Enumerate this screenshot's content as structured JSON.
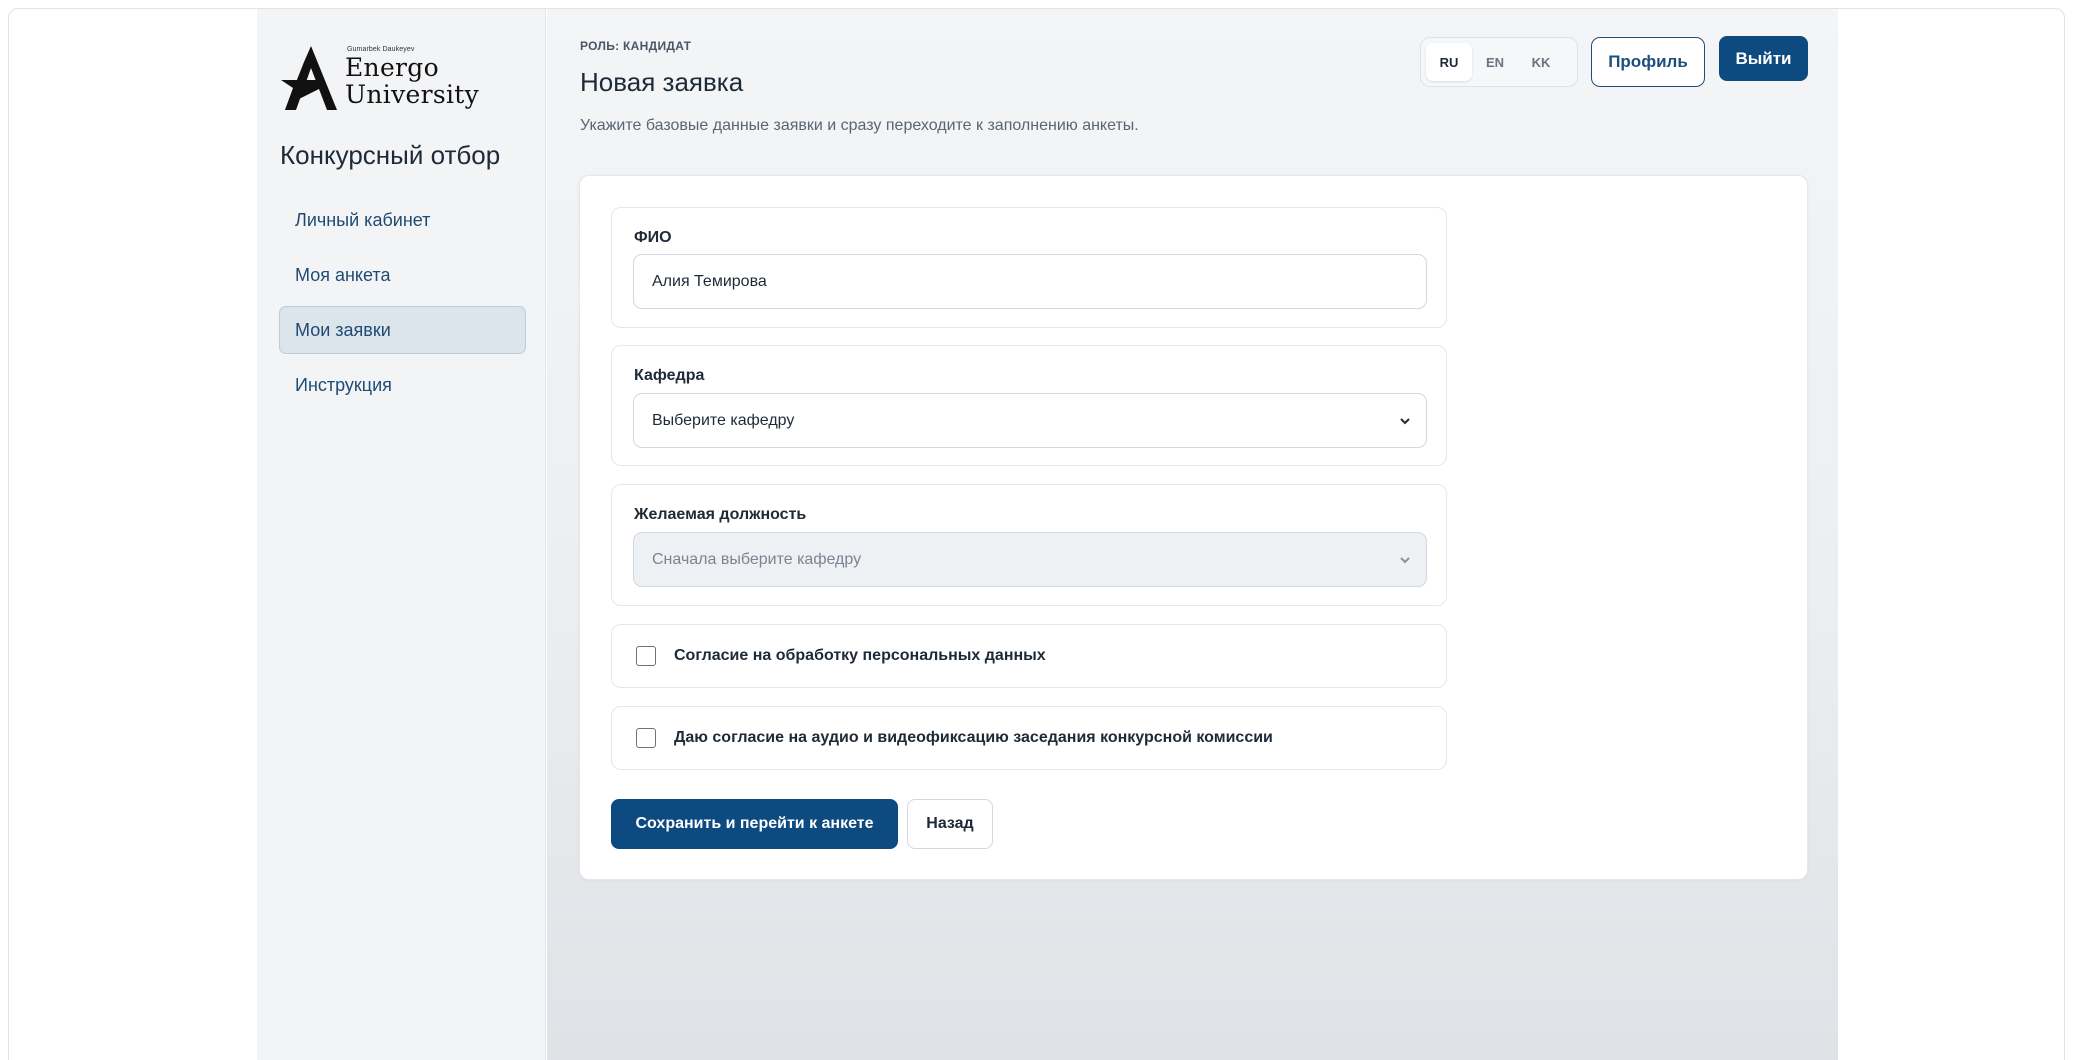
{
  "brand": {
    "logo_small": "Gumarbek Daukeyev",
    "logo_line1": "Energo",
    "logo_line2": "University",
    "title": "Конкурсный отбор"
  },
  "sidebar": {
    "items": [
      {
        "label": "Личный кабинет",
        "active": false
      },
      {
        "label": "Моя анкета",
        "active": false
      },
      {
        "label": "Мои заявки",
        "active": true
      },
      {
        "label": "Инструкция",
        "active": false
      }
    ]
  },
  "header": {
    "role": "РОЛЬ: КАНДИДАТ",
    "title": "Новая заявка",
    "subtitle": "Укажите базовые данные заявки и сразу переходите к заполнению анкеты.",
    "languages": [
      {
        "code": "RU",
        "active": true
      },
      {
        "code": "EN",
        "active": false
      },
      {
        "code": "KK",
        "active": false
      }
    ],
    "profile_label": "Профиль",
    "logout_label": "Выйти"
  },
  "form": {
    "fio": {
      "label": "ФИО",
      "value": "Алия Темирова"
    },
    "department": {
      "label": "Кафедра",
      "selected": "Выберите кафедру"
    },
    "position": {
      "label": "Желаемая должность",
      "selected": "Сначала выберите кафедру",
      "disabled": true
    },
    "consent_personal": {
      "label": "Согласие на обработку персональных данных",
      "checked": false
    },
    "consent_recording": {
      "label": "Даю согласие на аудио и видеофиксацию заседания конкурсной комиссии",
      "checked": false
    },
    "save_label": "Сохранить и перейти к анкете",
    "back_label": "Назад"
  },
  "icons": {
    "logo": "energo-university-logo",
    "select_arrow": "chevron-down-icon"
  },
  "colors": {
    "primary": "#0d4a80",
    "nav_text": "#1e4b73",
    "nav_active_bg": "#dce4ec"
  }
}
